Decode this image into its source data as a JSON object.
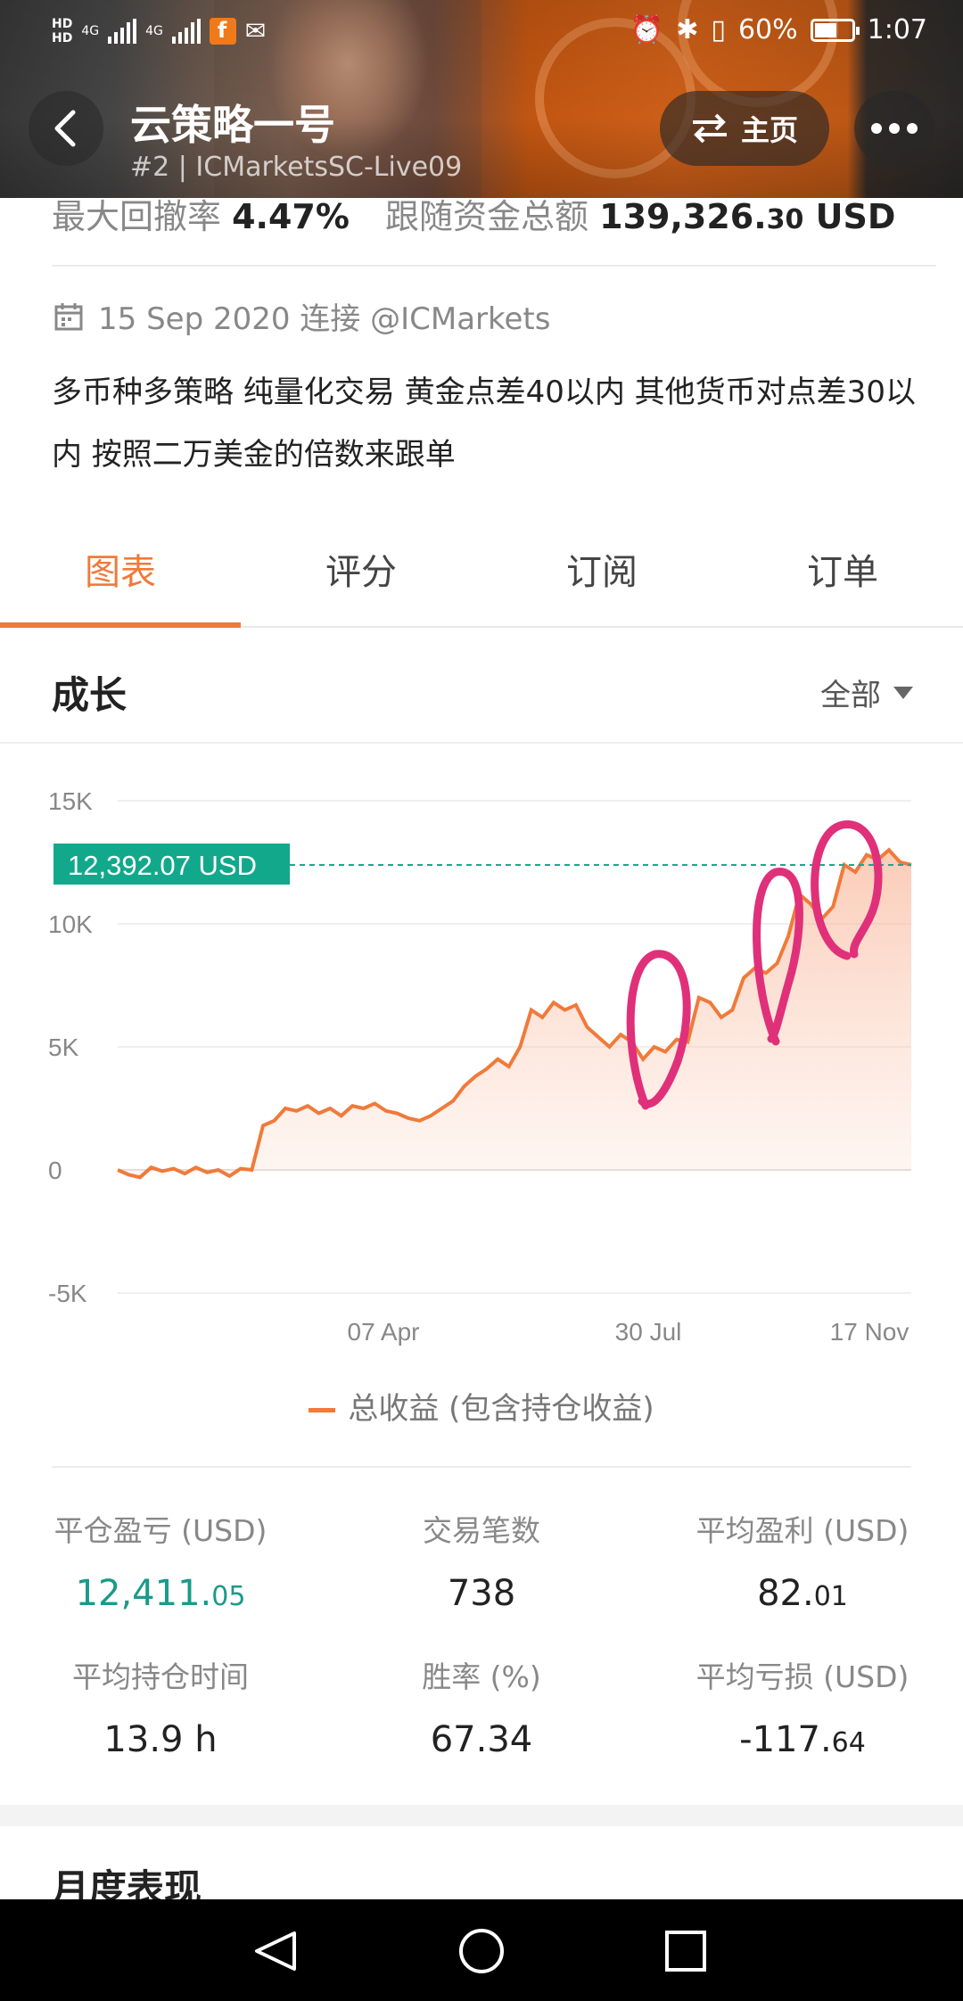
{
  "status_bar": {
    "signal_left": "HD",
    "network1": "4G",
    "network2": "4G",
    "battery_percent": "60%",
    "time": "1:07",
    "battery_level": 0.6
  },
  "header": {
    "title": "云策略一号",
    "subtitle": "#2 | ICMarketsSC-Live09",
    "home_label": "主页"
  },
  "stats_top": {
    "drawdown_label": "最大回撤率",
    "drawdown_value": "4.47%",
    "funds_label": "跟随资金总额",
    "funds_value_main": "139,326.",
    "funds_value_decimals": "30",
    "funds_currency": "USD"
  },
  "info": {
    "date_text": "15 Sep 2020 连接 @ICMarkets",
    "description": "多币种多策略  纯量化交易  黄金点差40以内  其他货币对点差30以内  按照二万美金的倍数来跟单"
  },
  "tabs": [
    {
      "label": "图表",
      "active": true
    },
    {
      "label": "评分",
      "active": false
    },
    {
      "label": "订阅",
      "active": false
    },
    {
      "label": "订单",
      "active": false
    }
  ],
  "section": {
    "title": "成长",
    "range_label": "全部"
  },
  "chart_data": {
    "type": "area",
    "y_tick_labels": [
      "15K",
      "10K",
      "5K",
      "0",
      "-5K"
    ],
    "x_tick_labels": [
      "07 Apr",
      "30 Jul",
      "17 Nov"
    ],
    "ylim": [
      -5000,
      15000
    ],
    "current_label": "12,392.07 USD",
    "current_value": 12392.07,
    "series": [
      {
        "name": "总收益 (包含持仓收益)",
        "color": "#f07a3a",
        "values": [
          0,
          -200,
          -300,
          100,
          -50,
          50,
          -150,
          100,
          -100,
          0,
          -250,
          50,
          0,
          1800,
          2000,
          2500,
          2400,
          2600,
          2300,
          2500,
          2200,
          2600,
          2500,
          2700,
          2400,
          2300,
          2100,
          2000,
          2200,
          2500,
          2800,
          3400,
          3800,
          4100,
          4500,
          4200,
          5000,
          6500,
          6200,
          6800,
          6500,
          6700,
          5800,
          5400,
          5000,
          5500,
          5200,
          4500,
          5000,
          4800,
          5300,
          5200,
          7000,
          6800,
          6200,
          6500,
          7800,
          8200,
          8000,
          8400,
          9500,
          11200,
          10800,
          10200,
          10700,
          12400,
          12100,
          12800,
          12600,
          13000,
          12500,
          12400
        ]
      }
    ],
    "grid": true
  },
  "metrics": [
    {
      "label": "平仓盈亏 (USD)",
      "main": "12,411.",
      "small": "05",
      "green": true
    },
    {
      "label": "交易笔数",
      "main": "738",
      "small": "",
      "green": false
    },
    {
      "label": "平均盈利 (USD)",
      "main": "82.",
      "small": "01",
      "green": false
    },
    {
      "label": "平均持仓时间",
      "main": "13.9 h",
      "small": "",
      "green": false
    },
    {
      "label": "胜率 (%)",
      "main": "67.34",
      "small": "",
      "green": false
    },
    {
      "label": "平均亏损 (USD)",
      "main": "-117.",
      "small": "64",
      "green": false
    }
  ],
  "monthly_title": "月度表现"
}
